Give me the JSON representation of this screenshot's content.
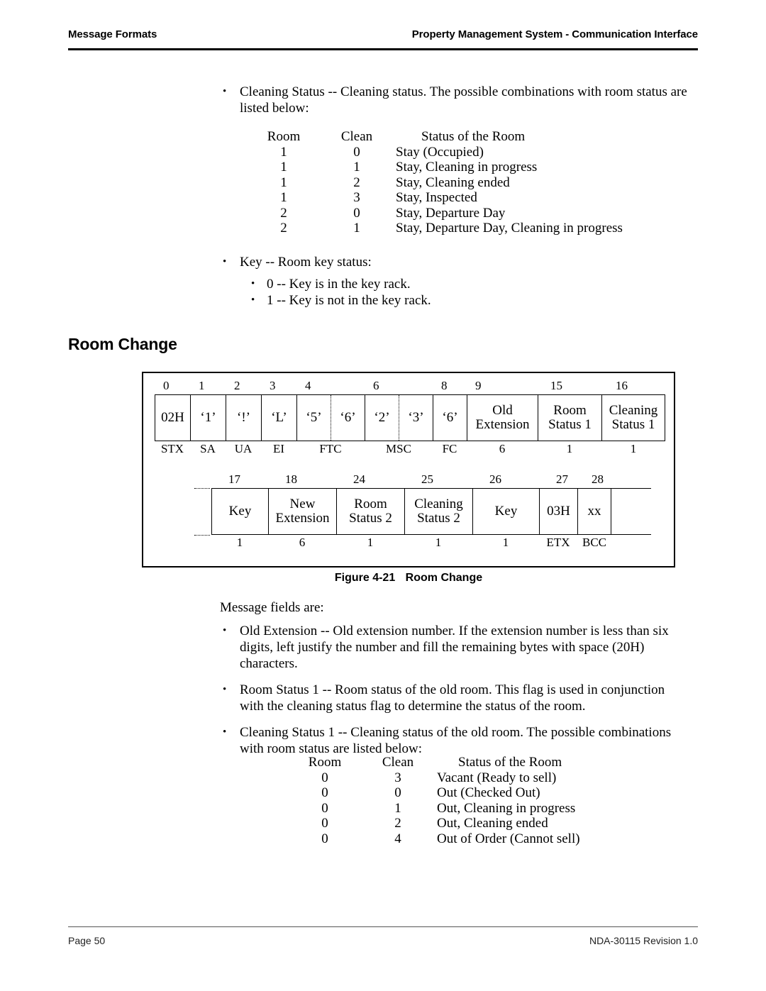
{
  "header": {
    "left": "Message Formats",
    "right": "Property Management System - Communication Interface"
  },
  "footer": {
    "left": "Page 50",
    "right": "NDA-30115  Revision 1.0"
  },
  "bullet_glyph": "•",
  "intro_bullet": {
    "text": "Cleaning Status -- Cleaning status. The possible combinations with room status are listed below:"
  },
  "status_table_1": {
    "headers": [
      "Room",
      "Clean",
      "Status of the Room"
    ],
    "rows": [
      [
        "1",
        "0",
        "Stay (Occupied)"
      ],
      [
        "1",
        "1",
        "Stay, Cleaning in progress"
      ],
      [
        "1",
        "2",
        "Stay, Cleaning ended"
      ],
      [
        "1",
        "3",
        "Stay, Inspected"
      ],
      [
        "2",
        "0",
        "Stay, Departure Day"
      ],
      [
        "2",
        "1",
        "Stay, Departure Day, Cleaning in progress"
      ]
    ]
  },
  "key_bullets": {
    "main": "Key -- Room key status:",
    "sub": [
      "0 -- Key is in the key rack.",
      "1 -- Key is not in the key rack."
    ]
  },
  "section_heading": "Room Change",
  "figure": {
    "caption_number": "Figure 4-21",
    "caption_title": "Room Change",
    "row1": {
      "offsets": [
        "0",
        "1",
        "2",
        "3",
        "4",
        "6",
        "8",
        "9",
        "15",
        "16"
      ],
      "cells": [
        {
          "line1": "02H",
          "line2": ""
        },
        {
          "line1": "‘1’",
          "line2": ""
        },
        {
          "line1": "‘!’",
          "line2": ""
        },
        {
          "line1": "‘L’",
          "line2": ""
        },
        {
          "line1": "‘5’",
          "line2": ""
        },
        {
          "line1": "‘6’",
          "line2": ""
        },
        {
          "line1": "‘2’",
          "line2": ""
        },
        {
          "line1": "‘3’",
          "line2": ""
        },
        {
          "line1": "‘6’",
          "line2": ""
        },
        {
          "line1": "Old",
          "line2": "Extension"
        },
        {
          "line1": "Room",
          "line2": "Status 1"
        },
        {
          "line1": "Cleaning",
          "line2": "Status 1"
        }
      ],
      "labels": [
        "STX",
        "SA",
        "UA",
        "EI",
        "FTC",
        "MSC",
        "FC",
        "6",
        "1",
        "1"
      ]
    },
    "row2": {
      "offsets": [
        "17",
        "18",
        "24",
        "25",
        "26",
        "27",
        "28"
      ],
      "cells": [
        {
          "line1": "Key",
          "line2": ""
        },
        {
          "line1": "New",
          "line2": "Extension"
        },
        {
          "line1": "Room",
          "line2": "Status 2"
        },
        {
          "line1": "Cleaning",
          "line2": "Status 2"
        },
        {
          "line1": "Key",
          "line2": ""
        },
        {
          "line1": "03H",
          "line2": ""
        },
        {
          "line1": "xx",
          "line2": ""
        }
      ],
      "labels": [
        "1",
        "6",
        "1",
        "1",
        "1",
        "ETX",
        "BCC"
      ]
    }
  },
  "fields_intro": "Message fields are:",
  "fields_bullets": [
    "Old Extension -- Old extension number. If the extension number is less than six digits, left justify the number and fill the remaining bytes with space (20H) characters.",
    "Room Status 1 -- Room status of the old room. This flag is used in conjunction with the cleaning status flag to determine the status of the room.",
    "Cleaning Status 1 -- Cleaning status of the old room. The possible combinations with room status are listed below:"
  ],
  "status_table_2": {
    "headers": [
      "Room",
      "Clean",
      "Status of the Room"
    ],
    "rows": [
      [
        "0",
        "3",
        "Vacant (Ready to sell)"
      ],
      [
        "0",
        "0",
        "Out (Checked Out)"
      ],
      [
        "0",
        "1",
        "Out, Cleaning in progress"
      ],
      [
        "0",
        "2",
        "Out, Cleaning ended"
      ],
      [
        "0",
        "4",
        "Out of Order (Cannot sell)"
      ]
    ]
  }
}
